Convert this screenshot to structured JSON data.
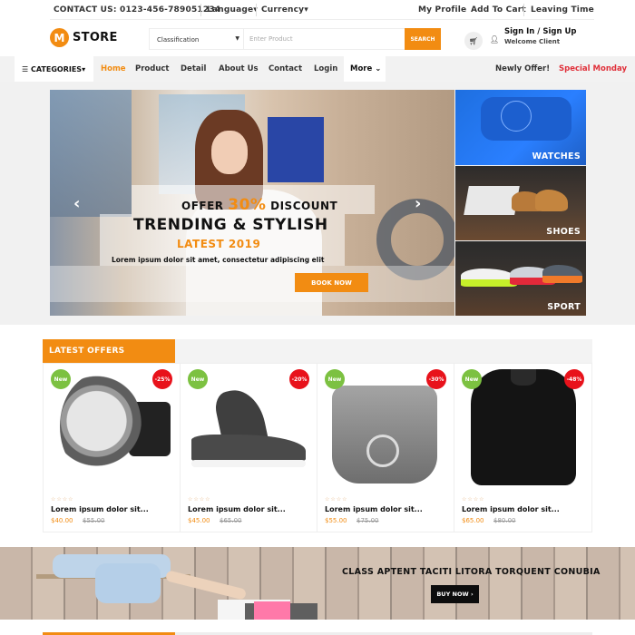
{
  "topbar": {
    "contact": "CONTACT US: 0123-456-789051234",
    "language": "Language",
    "currency": "Currency",
    "links": [
      "My Profile",
      "Add To Cart",
      "Leaving Time"
    ]
  },
  "header": {
    "logo_letter": "M",
    "logo_text": "STORE",
    "search": {
      "category": "Classification",
      "placeholder": "Enter Product",
      "button": "SEARCH"
    },
    "account": {
      "title": "Sign In / Sign Up",
      "subtitle": "Welcome Client"
    }
  },
  "nav": {
    "categories": "CATEGORIES",
    "items": [
      "Home",
      "Product",
      "Detail",
      "About Us",
      "Contact",
      "Login"
    ],
    "active": "Home",
    "more": "More",
    "newly_offer": "Newly Offer!",
    "special": "Special Monday"
  },
  "hero": {
    "offer_prefix": "OFFER",
    "offer_percent": "30%",
    "offer_suffix": "DISCOUNT",
    "title": "TRENDING & STYLISH",
    "subtitle": "LATEST 2019",
    "description": "Lorem ipsum dolor sit amet, consectetur adipiscing elit",
    "button": "BOOK NOW"
  },
  "side_tiles": [
    {
      "label": "WATCHES"
    },
    {
      "label": "SHOES"
    },
    {
      "label": "SPORT"
    }
  ],
  "latest_offers": {
    "title": "LATEST OFFERS",
    "products": [
      {
        "badge_new": "New",
        "discount": "-25%",
        "name": "Lorem ipsum dolor sit...",
        "price": "$40.00",
        "old_price": "$55.00",
        "rating": 0
      },
      {
        "badge_new": "New",
        "discount": "-20%",
        "name": "Lorem ipsum dolor sit...",
        "price": "$45.00",
        "old_price": "$65.00",
        "rating": 0
      },
      {
        "badge_new": "New",
        "discount": "-30%",
        "name": "Lorem ipsum dolor sit...",
        "price": "$55.00",
        "old_price": "$75.00",
        "rating": 0
      },
      {
        "badge_new": "New",
        "discount": "-48%",
        "name": "Lorem ipsum dolor sit...",
        "price": "$65.00",
        "old_price": "$80.00",
        "rating": 0
      }
    ]
  },
  "banner": {
    "headline": "CLASS APTENT TACITI LITORA TORQUENT CONUBIA",
    "button": "BUY NOW"
  },
  "colors": {
    "accent": "#f28c12",
    "special": "#e0303a",
    "new_badge": "#7cc141",
    "discount_badge": "#e8121b"
  }
}
